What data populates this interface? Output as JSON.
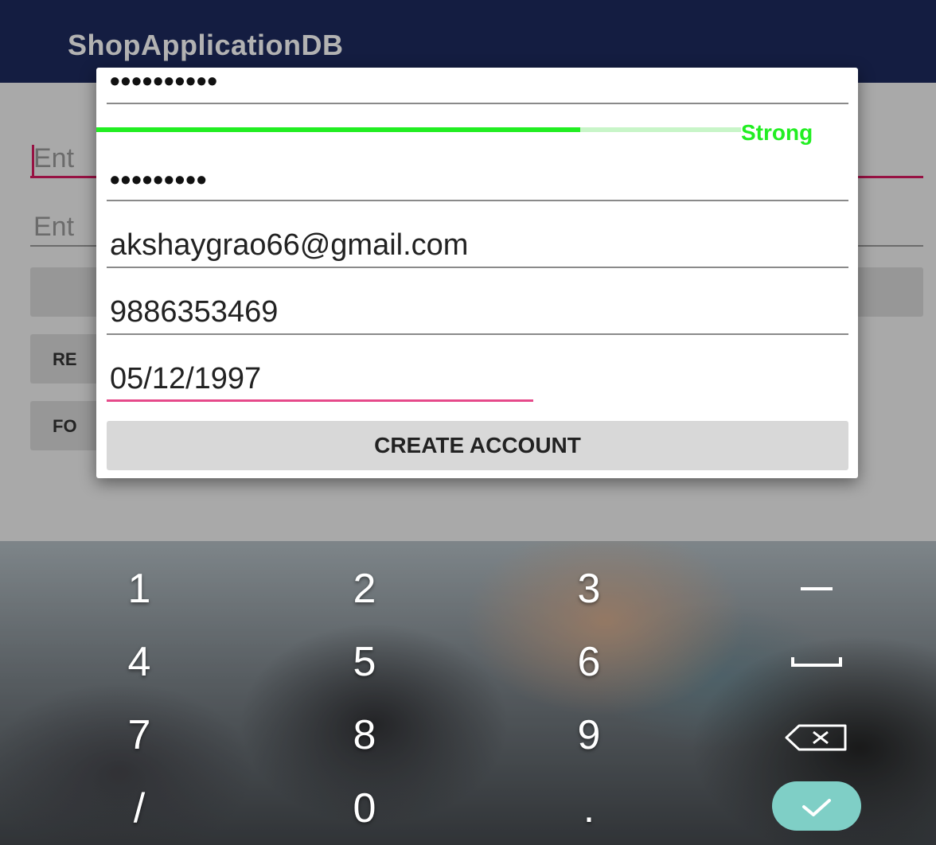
{
  "app": {
    "title": "ShopApplicationDB",
    "bg_field1_hint": "Ent",
    "bg_field2_hint": "Ent",
    "bg_button1": "RE",
    "bg_button2": "FO"
  },
  "dialog": {
    "password_mask": "••••••••••",
    "strength_label": "Strong",
    "strength_fraction": 0.75,
    "confirm_password_mask": "•••••••••",
    "email_value": "akshaygrao66@gmail.com",
    "phone_value": "9886353469",
    "dob_value": "05/12/1997",
    "create_button_label": "CREATE ACCOUNT"
  },
  "keyboard": {
    "keys": [
      "1",
      "2",
      "3",
      "4",
      "5",
      "6",
      "7",
      "8",
      "9",
      "/",
      "0",
      "."
    ],
    "function_keys": [
      "minus-icon",
      "space-icon",
      "backspace-icon",
      "done-check-icon"
    ],
    "colors": {
      "done_key": "#7fcfc6",
      "strength_green": "#22ee22",
      "focus_pink": "#e64a8a",
      "app_bar": "#1e2a5e"
    }
  }
}
